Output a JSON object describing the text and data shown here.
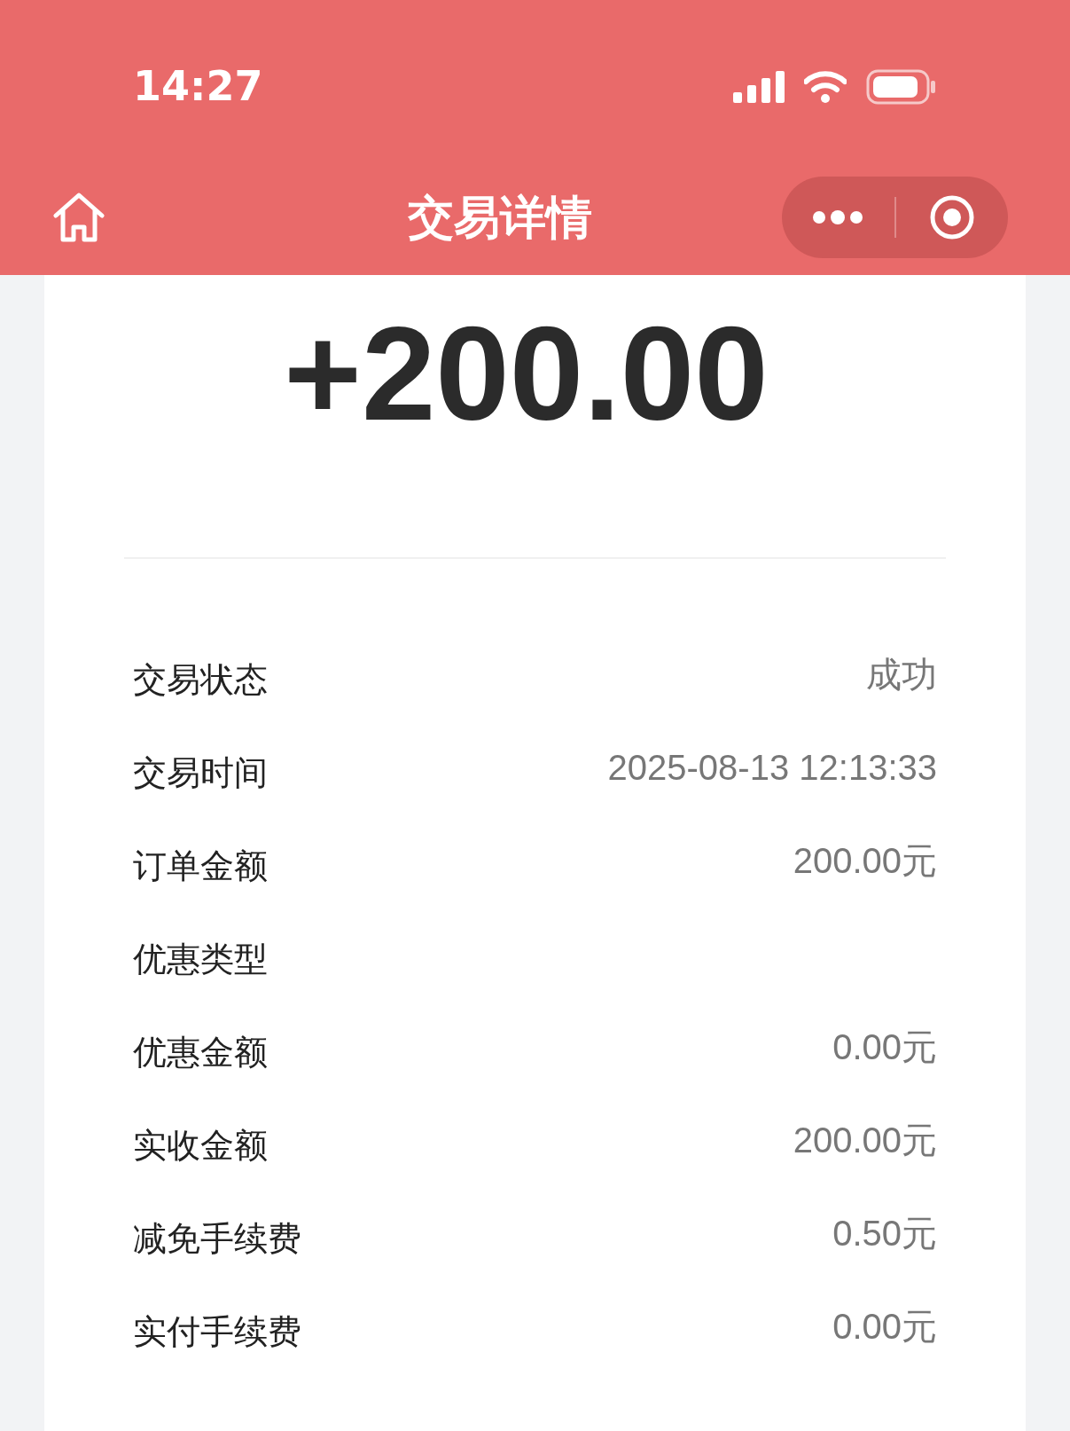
{
  "status_bar": {
    "time": "14:27"
  },
  "nav": {
    "title": "交易详情"
  },
  "amount": "+200.00",
  "details": [
    {
      "label": "交易状态",
      "value": "成功"
    },
    {
      "label": "交易时间",
      "value": "2025-08-13 12:13:33"
    },
    {
      "label": "订单金额",
      "value": "200.00元"
    },
    {
      "label": "优惠类型"
    },
    {
      "label": "优惠金额",
      "value": "0.00元"
    },
    {
      "label": "实收金额",
      "value": "200.00元"
    },
    {
      "label": "减免手续费",
      "value": "0.50元"
    },
    {
      "label": "实付手续费",
      "value": "0.00元"
    }
  ]
}
